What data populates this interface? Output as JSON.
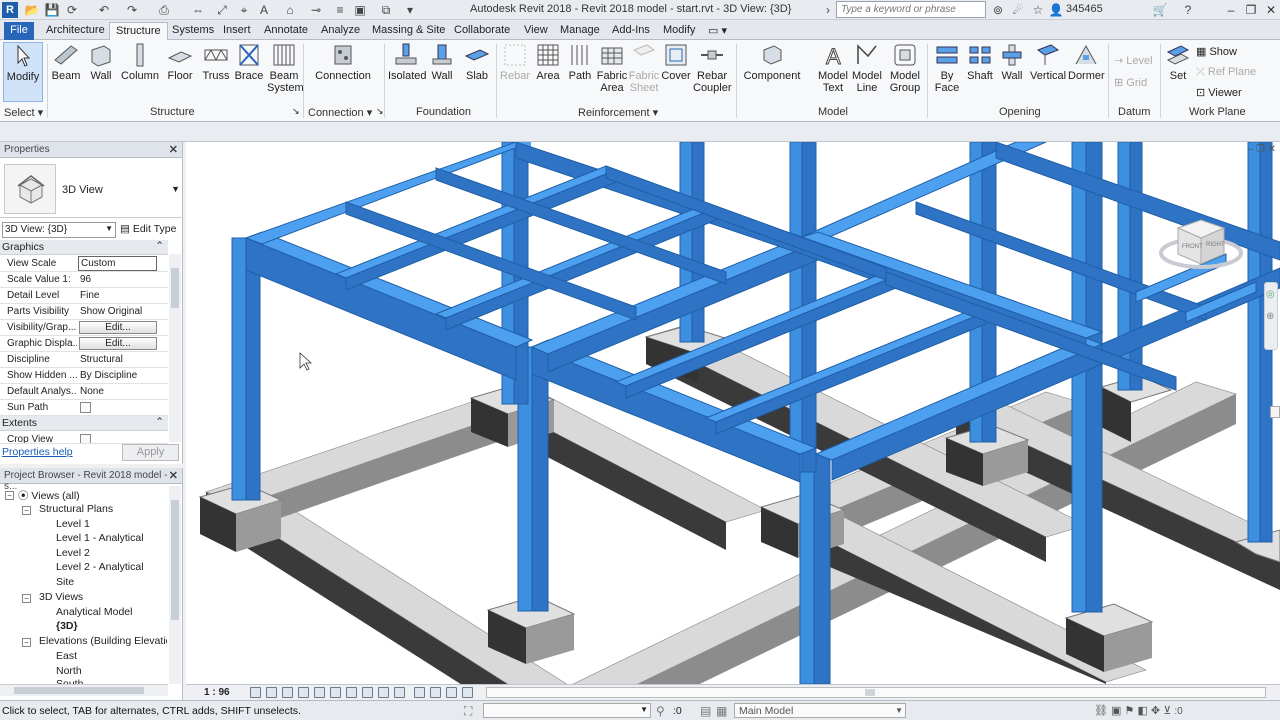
{
  "titlebar": {
    "title": "Autodesk Revit 2018 -   Revit 2018 model - start.rvt - 3D View: {3D}",
    "search_placeholder": "Type a keyword or phrase",
    "user": "345465",
    "app_logo": "R"
  },
  "tabs": [
    {
      "label": "File"
    },
    {
      "label": "Architecture"
    },
    {
      "label": "Structure"
    },
    {
      "label": "Systems"
    },
    {
      "label": "Insert"
    },
    {
      "label": "Annotate"
    },
    {
      "label": "Analyze"
    },
    {
      "label": "Massing & Site"
    },
    {
      "label": "Collaborate"
    },
    {
      "label": "View"
    },
    {
      "label": "Manage"
    },
    {
      "label": "Add-Ins"
    },
    {
      "label": "Modify"
    }
  ],
  "ribbon": {
    "modify": "Modify",
    "select": "Select",
    "structure_tools": [
      "Beam",
      "Wall",
      "Column",
      "Floor",
      "Truss",
      "Brace",
      "Beam System"
    ],
    "structure_label": "Structure",
    "connection": "Connection",
    "connection_label": "Connection",
    "foundation_tools": [
      "Isolated",
      "Wall",
      "Slab"
    ],
    "foundation_label": "Foundation",
    "reinforcement_tools": [
      "Rebar",
      "Area",
      "Path",
      "Fabric Area",
      "Fabric Sheet",
      "Cover",
      "Rebar Coupler"
    ],
    "reinforcement_label": "Reinforcement",
    "model_tools": [
      "Component",
      "Model Text",
      "Model Line",
      "Model Group"
    ],
    "model_label": "Model",
    "opening_tools": [
      "By Face",
      "Shaft",
      "Wall",
      "Vertical",
      "Dormer"
    ],
    "opening_label": "Opening",
    "datum_tools": [
      "Level",
      "Grid"
    ],
    "datum_label": "Datum",
    "workplane_set": "Set",
    "workplane_tools": [
      "Show",
      "Ref Plane",
      "Viewer"
    ],
    "workplane_label": "Work Plane"
  },
  "properties": {
    "header": "Properties",
    "type_name": "3D View",
    "view_filter": "3D View: {3D}",
    "edit_type": "Edit Type",
    "section_graphics": "Graphics",
    "section_extents": "Extents",
    "rows": [
      {
        "name": "View Scale",
        "value": "Custom"
      },
      {
        "name": "Scale Value    1:",
        "value": "96"
      },
      {
        "name": "Detail Level",
        "value": "Fine"
      },
      {
        "name": "Parts Visibility",
        "value": "Show Original"
      },
      {
        "name": "Visibility/Grap...",
        "value": "Edit..."
      },
      {
        "name": "Graphic Displa...",
        "value": "Edit..."
      },
      {
        "name": "Discipline",
        "value": "Structural"
      },
      {
        "name": "Show Hidden ...",
        "value": "By Discipline"
      },
      {
        "name": "Default Analys...",
        "value": "None"
      },
      {
        "name": "Sun Path",
        "value": ""
      }
    ],
    "crop_view": "Crop View",
    "help": "Properties help",
    "apply": "Apply"
  },
  "browser": {
    "header": "Project Browser - Revit 2018 model - s...",
    "items": [
      {
        "label": "Views (all)"
      },
      {
        "label": "Structural Plans"
      },
      {
        "label": "Level 1"
      },
      {
        "label": "Level 1 - Analytical"
      },
      {
        "label": "Level 2"
      },
      {
        "label": "Level 2 - Analytical"
      },
      {
        "label": "Site"
      },
      {
        "label": "3D Views"
      },
      {
        "label": "Analytical Model"
      },
      {
        "label": "{3D}"
      },
      {
        "label": "Elevations (Building Elevation)"
      },
      {
        "label": "East"
      },
      {
        "label": "North"
      },
      {
        "label": "South"
      }
    ]
  },
  "viewcube": {
    "front": "FRONT",
    "right": "RIGHT"
  },
  "viewbar": {
    "scale": "1 : 96"
  },
  "statusbar": {
    "message": "Click to select, TAB for alternates, CTRL adds, SHIFT unselects.",
    "count": ":0",
    "model": "Main Model"
  },
  "colors": {
    "steel": "#3d8fe0",
    "steel_dark": "#1f5fa8",
    "concrete_top": "#d9d9d9",
    "concrete_side": "#3a3a3a",
    "accent": "#2766b8"
  }
}
